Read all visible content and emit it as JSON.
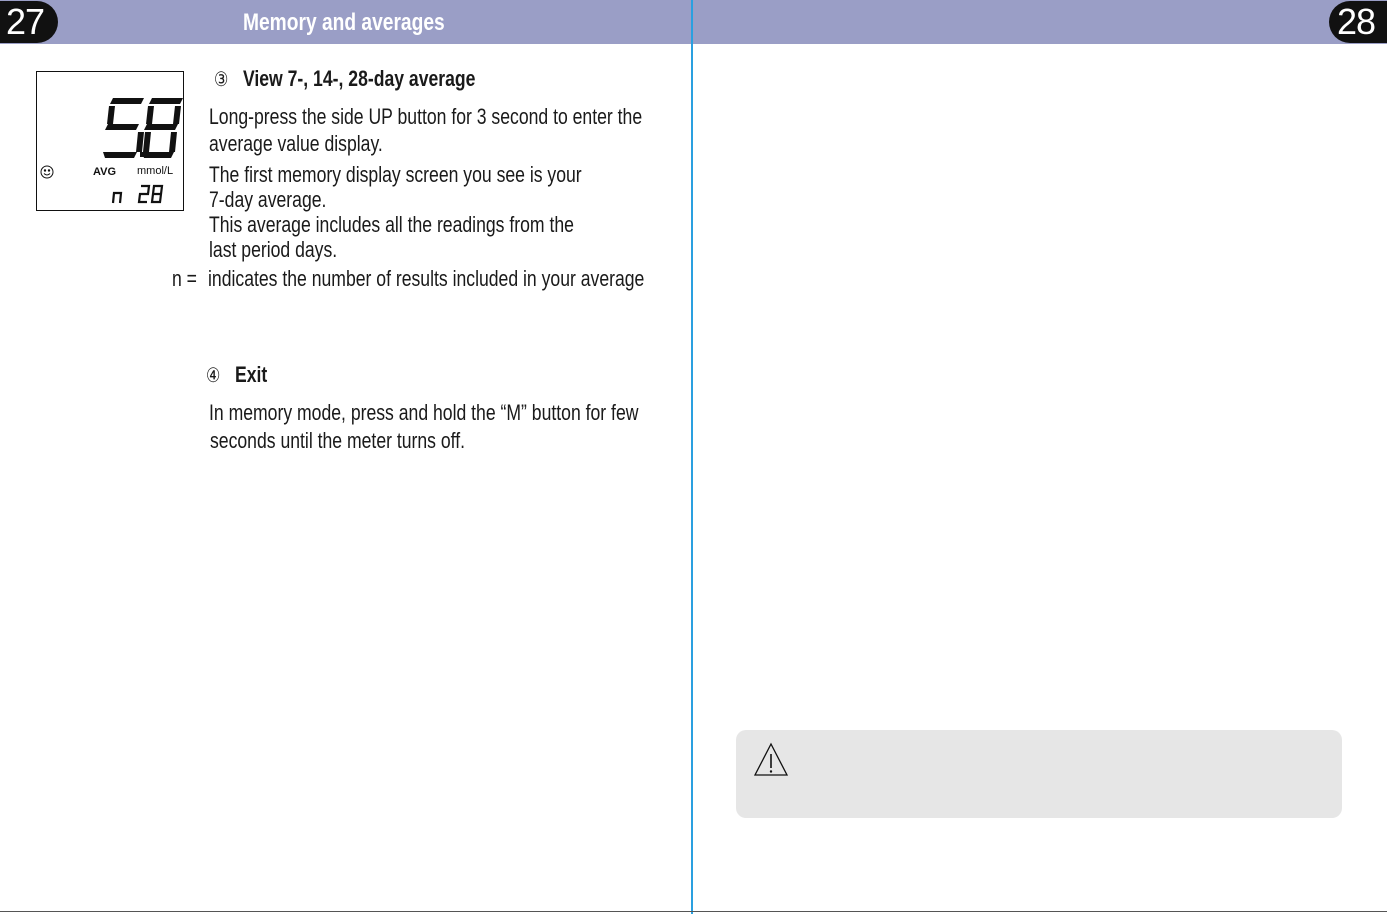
{
  "header": {
    "left_page_number": "27",
    "right_page_number": "28",
    "title": "Memory and averages"
  },
  "display": {
    "reading": "5.8",
    "avg_label": "AVG",
    "unit": "mmol/L",
    "count_prefix": "n",
    "count_value": "28",
    "smiley_icon": "smiley-face-icon"
  },
  "section3": {
    "number": "③",
    "heading": "View 7-, 14-, 28-day average",
    "lines": [
      "Long-press the side UP button for 3 second to enter the",
      "average value display.",
      "The first memory display screen you see is your",
      "7-day average.",
      "This average includes all the readings from the",
      "last period days."
    ],
    "n_label": "n =",
    "n_text": "indicates the number of results included in your average"
  },
  "section4": {
    "number": "④",
    "heading": "Exit",
    "lines": [
      "In memory mode, press and hold the “M” button for few",
      "seconds until the meter turns off."
    ]
  },
  "note": {
    "icon": "warning-triangle-icon"
  },
  "colors": {
    "header_band": "#9a9ec6",
    "divider": "#2aa0e0",
    "note_box": "#e6e6e6",
    "badge": "#111111"
  }
}
